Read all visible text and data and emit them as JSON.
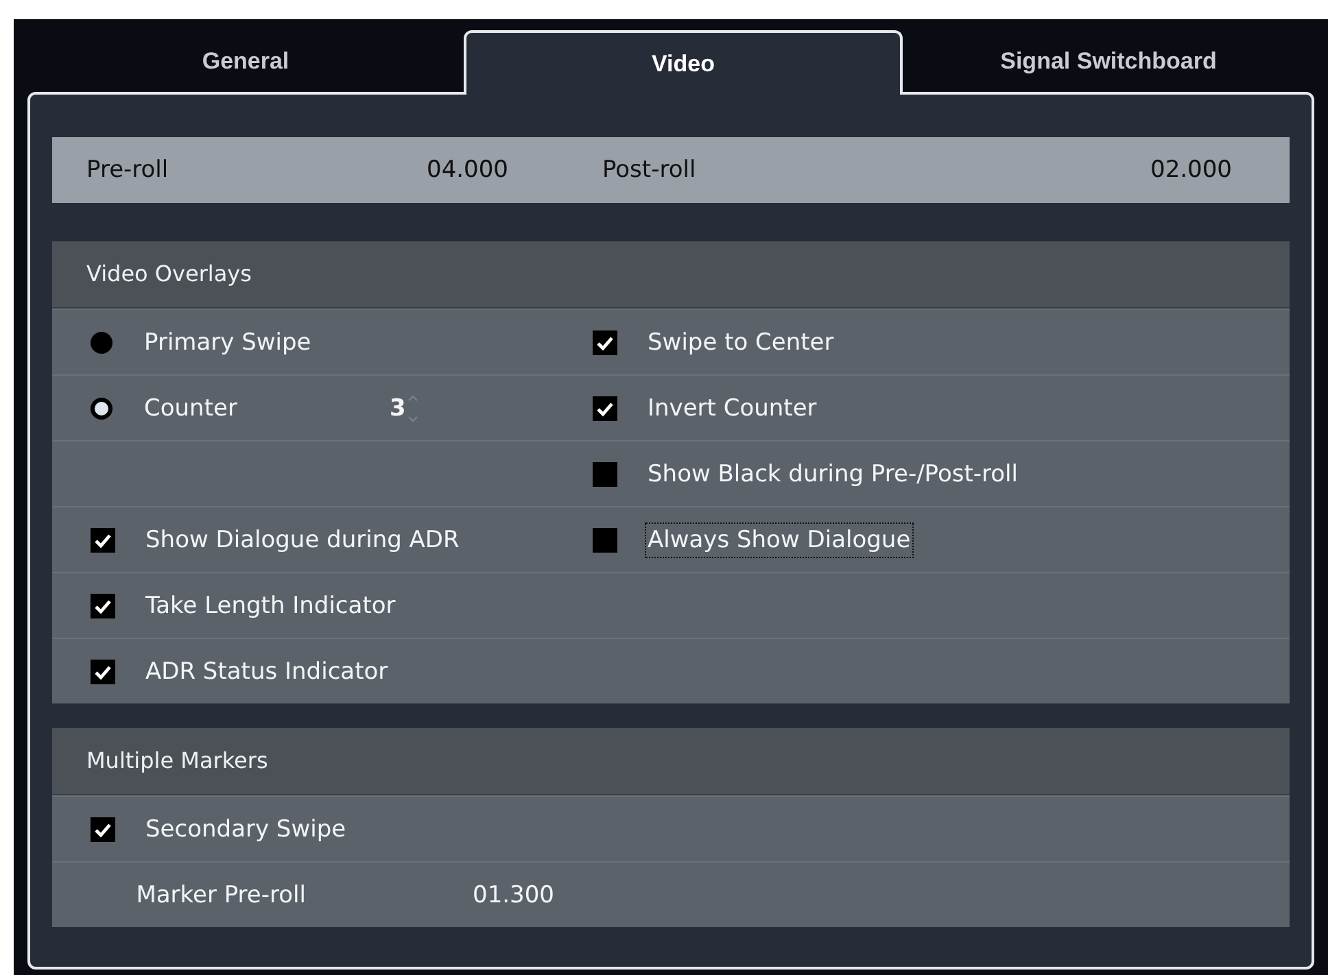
{
  "tabs": [
    {
      "label": "General",
      "selected": false
    },
    {
      "label": "Video",
      "selected": true
    },
    {
      "label": "Signal Switchboard",
      "selected": false
    }
  ],
  "roll_bar": {
    "pre_label": "Pre-roll",
    "pre_value": "04.000",
    "post_label": "Post-roll",
    "post_value": "02.000"
  },
  "sections": [
    {
      "title": "Video Overlays",
      "rows": [
        {
          "left": {
            "kind": "radio",
            "label": "Primary Swipe",
            "selected": false
          },
          "right": {
            "kind": "checkbox",
            "label": "Swipe to Center",
            "checked": true,
            "focused": false
          }
        },
        {
          "left": {
            "kind": "radio",
            "label": "Counter",
            "selected": true,
            "value": "3"
          },
          "right": {
            "kind": "checkbox",
            "label": "Invert Counter",
            "checked": true,
            "focused": false
          }
        },
        {
          "right": {
            "kind": "checkbox",
            "label": "Show Black during Pre-/Post-roll",
            "checked": false,
            "focused": false
          }
        },
        {
          "left": {
            "kind": "checkbox",
            "label": "Show Dialogue during ADR",
            "checked": true
          },
          "right": {
            "kind": "checkbox",
            "label": "Always Show Dialogue",
            "checked": false,
            "focused": true
          }
        },
        {
          "left": {
            "kind": "checkbox",
            "label": "Take Length Indicator",
            "checked": true
          }
        },
        {
          "left": {
            "kind": "checkbox",
            "label": "ADR Status Indicator",
            "checked": true
          }
        }
      ]
    },
    {
      "title": "Multiple Markers",
      "rows": [
        {
          "left": {
            "kind": "checkbox",
            "label": "Secondary Swipe",
            "checked": true
          }
        },
        {
          "left": {
            "kind": "value",
            "label": "Marker Pre-roll",
            "value": "01.300"
          }
        }
      ]
    }
  ]
}
